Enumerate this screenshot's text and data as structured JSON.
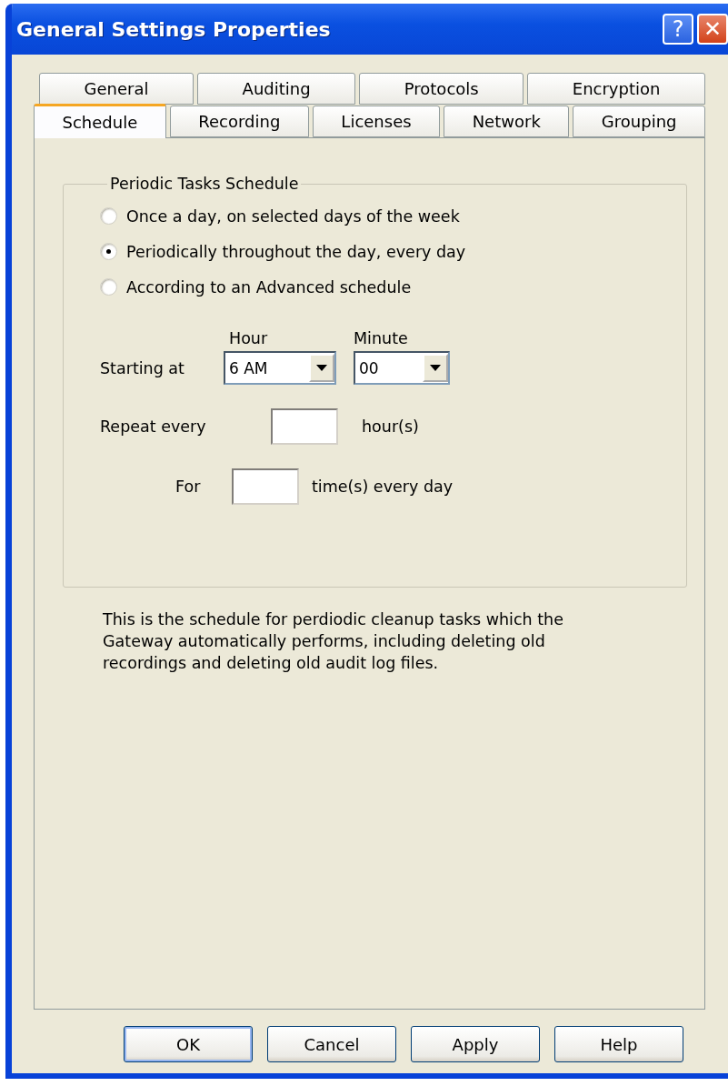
{
  "window": {
    "title": "General Settings Properties"
  },
  "title_buttons": [
    {
      "kind": "help",
      "label": "?"
    },
    {
      "kind": "close",
      "label": "✕"
    }
  ],
  "tab_rows": [
    [
      {
        "label": "General",
        "selected": false
      },
      {
        "label": "Auditing",
        "selected": false
      },
      {
        "label": "Protocols",
        "selected": false
      },
      {
        "label": "Encryption",
        "selected": false
      }
    ],
    [
      {
        "label": "Schedule",
        "selected": true
      },
      {
        "label": "Recording",
        "selected": false
      },
      {
        "label": "Licenses",
        "selected": false
      },
      {
        "label": "Network",
        "selected": false
      },
      {
        "label": "Grouping",
        "selected": false
      }
    ]
  ],
  "group": {
    "title": "Periodic Tasks Schedule",
    "options": [
      {
        "label": "Once a day, on selected days of the week",
        "selected": false
      },
      {
        "label": "Periodically throughout the day, every day",
        "selected": true
      },
      {
        "label": "According to an Advanced schedule",
        "selected": false
      }
    ],
    "starting": {
      "label": "Starting at",
      "hour_label": "Hour",
      "hour": "6 AM",
      "minute_label": "Minute",
      "minute": "00"
    },
    "repeat": {
      "label": "Repeat every",
      "unit": "hour(s)"
    },
    "count": {
      "label": "For",
      "unit": "time(s) every day"
    }
  },
  "description": "This is the schedule for perdiodic cleanup tasks which the Gateway automatically performs, including deleting old recordings and deleting old audit log files.",
  "buttons": [
    {
      "label": "OK",
      "default": true
    },
    {
      "label": "Cancel",
      "default": false
    },
    {
      "label": "Apply",
      "default": false
    },
    {
      "label": "Help",
      "default": false
    }
  ]
}
